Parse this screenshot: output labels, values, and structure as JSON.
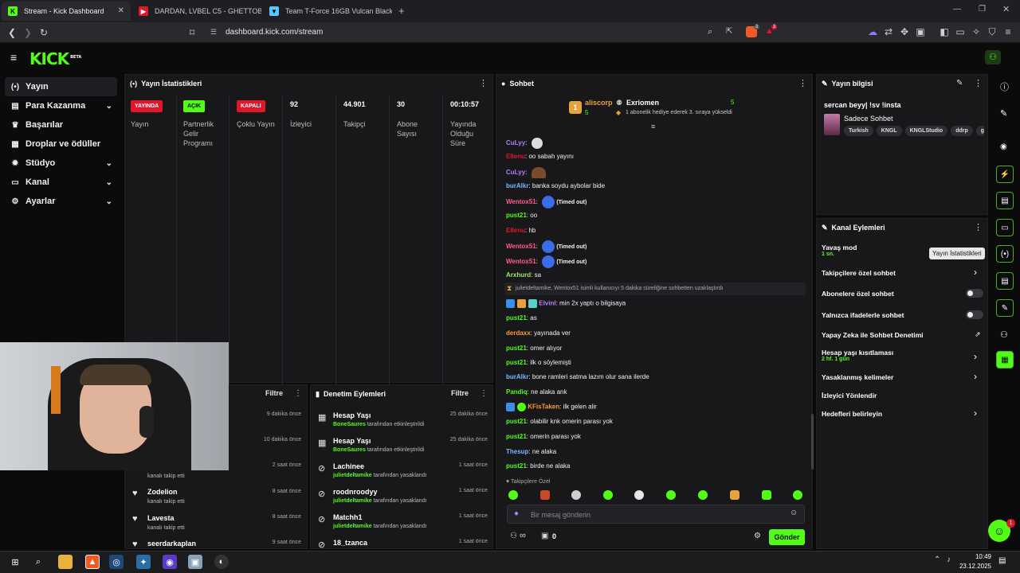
{
  "browser": {
    "tabs": [
      {
        "title": "Stream - Kick Dashboard",
        "close": "✕"
      },
      {
        "title": "DARDAN, LVBEL C5 - GHETTOBÉBÉ (",
        "close": ""
      },
      {
        "title": "Team T-Force 16GB Vulcan Black Exp",
        "close": ""
      }
    ],
    "new_tab": "+",
    "url": "dashboard.kick.com/stream",
    "ext_badge_1": "2",
    "ext_badge_2": "3"
  },
  "app": {
    "logo": "KICK",
    "logo_sup": "BETA"
  },
  "sidebar": {
    "items": [
      {
        "label": "Yayın",
        "icon": "broadcast-icon",
        "glyph": "(•)",
        "chev": ""
      },
      {
        "label": "Para Kazanma",
        "icon": "wallet-icon",
        "glyph": "▤",
        "chev": "⌄"
      },
      {
        "label": "Başarılar",
        "icon": "trophy-icon",
        "glyph": "🏆",
        "chev": ""
      },
      {
        "label": "Droplar ve ödüller",
        "icon": "gift-icon",
        "glyph": "▦",
        "chev": ""
      },
      {
        "label": "Stüdyo",
        "icon": "gear-icon",
        "glyph": "✹",
        "chev": "⌄"
      },
      {
        "label": "Kanal",
        "icon": "tv-icon",
        "glyph": "▭",
        "chev": "⌄"
      },
      {
        "label": "Ayarlar",
        "icon": "settings-icon",
        "glyph": "⚙",
        "chev": "⌄"
      }
    ]
  },
  "stats": {
    "title": "Yayın İstatistikleri",
    "columns": [
      {
        "badge": "YAYINDA",
        "label": "Yayın",
        "badge_color": "#e0162b",
        "badge_text": "#ffffff"
      },
      {
        "badge": "AÇIK",
        "label": "Partnerlik Gelir Programı",
        "badge_color": "#53fc18",
        "badge_text": "#0b0b0c"
      },
      {
        "badge": "KAPALI",
        "label": "Çoklu Yayın",
        "badge_color": "#e0162b",
        "badge_text": "#ffffff"
      },
      {
        "value": "92",
        "label": "İzleyici"
      },
      {
        "value": "44.901",
        "label": "Takipçi"
      },
      {
        "value": "30",
        "label": "Abone Sayısı"
      },
      {
        "value": "00:10:57",
        "label": "Yayında Olduğu Süre"
      }
    ]
  },
  "activity": {
    "filter": "Filtre",
    "items": [
      {
        "name": "",
        "sub": "",
        "time": "9 dakika önce"
      },
      {
        "name": "",
        "sub": "",
        "time": "10 dakika önce"
      },
      {
        "name": "",
        "sub": "kanalı takip etti",
        "time": "2 saat önce"
      },
      {
        "name": "Zodelion",
        "sub": "kanalı takip etti",
        "time": "8 saat önce"
      },
      {
        "name": "Lavesta",
        "sub": "kanalı takip etti",
        "time": "8 saat önce"
      },
      {
        "name": "seerdarkaplan",
        "sub": "",
        "time": "9 saat önce"
      }
    ]
  },
  "moderation": {
    "title": "Denetim Eylemleri",
    "filter": "Filtre",
    "items": [
      {
        "name": "Hesap Yaşı",
        "actor": "BoneSaures",
        "sub": "tarafından etkinleştirildi",
        "time": "25 dakika önce",
        "icon": "calendar-icon",
        "glyph": "▦"
      },
      {
        "name": "Hesap Yaşı",
        "actor": "BoneSaures",
        "sub": "tarafından etkinleştirildi",
        "time": "25 dakika önce",
        "icon": "calendar-icon",
        "glyph": "▦"
      },
      {
        "name": "Lachinee",
        "actor": "julietdeltamike",
        "sub": "tarafından yasaklandı",
        "time": "1 saat önce",
        "icon": "ban-icon",
        "glyph": "⊘"
      },
      {
        "name": "roodnroodyy",
        "actor": "julietdeltamike",
        "sub": "tarafından yasaklandı",
        "time": "1 saat önce",
        "icon": "ban-icon",
        "glyph": "⊘"
      },
      {
        "name": "Matchh1",
        "actor": "julietdeltamike",
        "sub": "tarafından yasaklandı",
        "time": "1 saat önce",
        "icon": "ban-icon",
        "glyph": "⊘"
      },
      {
        "name": "18_tzanca",
        "actor": "",
        "sub": "",
        "time": "1 saat önce",
        "icon": "ban-icon",
        "glyph": "⊘"
      }
    ]
  },
  "chat": {
    "title": "Sohbet",
    "pinned": {
      "rank": "1",
      "user": "aliscorp",
      "user_count": "5",
      "target": "Exriomen",
      "target_count": "5",
      "message": "1 abonelik hediye ederek 3. sıraya yükseldi"
    },
    "messages": [
      {
        "user": "CuLyy",
        "color": "#b57cff",
        "text": "",
        "emote": "#ddd"
      },
      {
        "user": "Ellenu",
        "color": "#e0162b",
        "text": "oo sabah yayını",
        "emote": ""
      },
      {
        "user": "CuLyy",
        "color": "#b57cff",
        "text": "",
        "emote": "#7a4a2a"
      },
      {
        "user": "burAlkr",
        "color": "#7ab8ff",
        "text": "banka soydu aybolar bide",
        "emote": ""
      },
      {
        "user": "Wentox51",
        "color": "#ff5c8a",
        "text": "(Timed out)",
        "emote": "#3a6ee8"
      },
      {
        "user": "pust21",
        "color": "#53fc18",
        "text": "oo",
        "emote": ""
      },
      {
        "user": "Ellenu",
        "color": "#e0162b",
        "text": "hb",
        "emote": ""
      },
      {
        "user": "Wentox51",
        "color": "#ff5c8a",
        "text": "(Timed out)",
        "emote": "#3a6ee8"
      },
      {
        "user": "Wentox51",
        "color": "#ff5c8a",
        "text": "(Timed out)",
        "emote": "#3a6ee8"
      },
      {
        "user": "Arxhurd",
        "color": "#9be86b",
        "text": "sa",
        "emote": ""
      }
    ],
    "system": "julietdeltamike, Wentox51 isimli kullanıcıyı 5 dakika süreliğine sohbetten uzaklaştırdı",
    "messages2": [
      {
        "user": "Elvinl",
        "color": "#b57cff",
        "text": "min 2x yaptı o bilgisaya"
      },
      {
        "user": "pust21",
        "color": "#53fc18",
        "text": "as"
      },
      {
        "user": "derdaxx",
        "color": "#ff9933",
        "text": "yayınada ver"
      },
      {
        "user": "pust21",
        "color": "#53fc18",
        "text": "omer alıyor"
      },
      {
        "user": "pust21",
        "color": "#53fc18",
        "text": "ilk o söylemişti"
      },
      {
        "user": "burAlkr",
        "color": "#7ab8ff",
        "text": "bone ramleri satma lazım olur sana ilerde"
      },
      {
        "user": "Pandiq",
        "color": "#53fc18",
        "text": "ne alaka ank"
      },
      {
        "user": "KFisTaken",
        "color": "#ff9933",
        "text": "ilk gelen alir"
      },
      {
        "user": "pust21",
        "color": "#53fc18",
        "text": "olabilir knk omerin parası yok"
      },
      {
        "user": "pust21",
        "color": "#53fc18",
        "text": "omerin parası yok"
      },
      {
        "user": "Thesup",
        "color": "#7ab8ff",
        "text": "ne alaka"
      },
      {
        "user": "pust21",
        "color": "#53fc18",
        "text": "birde ne alaka"
      }
    ],
    "followers_only": "Takipçilere Özel",
    "input_placeholder": "Bir mesaj gönderin",
    "infinity": "∞",
    "count": "0",
    "send": "Gönder"
  },
  "stream_info": {
    "title": "Yayın bilgisi",
    "stream_title": "sercan beyy| !sv !insta",
    "category": "Sadece Sohbet",
    "tags": [
      "Turkish",
      "KNGL",
      "KNGLStudio",
      "ddrp",
      "g"
    ]
  },
  "channel_actions": {
    "title": "Kanal Eylemleri",
    "slow_mode": "Yavaş mod",
    "slow_mode_value": "1 sn.",
    "followers_chat": "Takipçilere özel sohbet",
    "subs_chat": "Abonelere özel sohbet",
    "emotes_chat": "Yalnızca ifadelerle sohbet",
    "ai_moderation": "Yapay Zeka ile Sohbet Denetimi",
    "account_age": "Hesap yaşı kısıtlaması",
    "account_age_value": "2 hf. 1 gün",
    "banned_words": "Yasaklanmış kelimeler",
    "redirect": "İzleyici Yönlendir",
    "goals": "Hedefleri belirleyin"
  },
  "tooltip": "Yayın İstatistikleri",
  "support_badge": "1",
  "taskbar": {
    "time": "10:49",
    "date": "23.12.2025"
  }
}
